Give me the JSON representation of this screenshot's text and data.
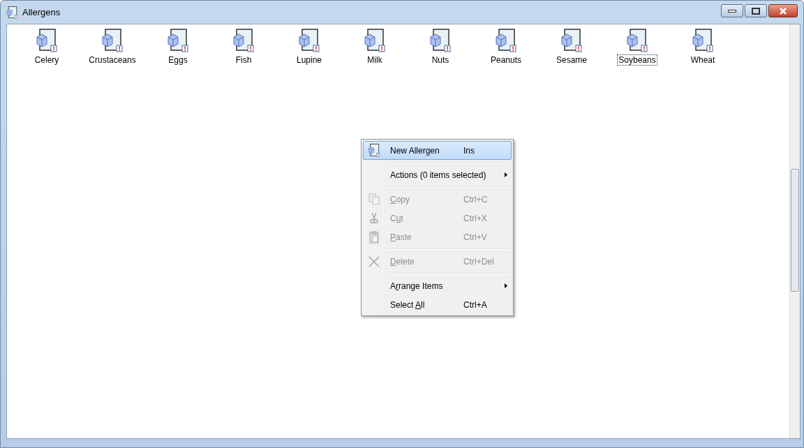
{
  "window": {
    "title": "Allergens"
  },
  "items": [
    {
      "label": "Celery",
      "focused": false
    },
    {
      "label": "Crustaceans",
      "focused": false
    },
    {
      "label": "Eggs",
      "focused": false
    },
    {
      "label": "Fish",
      "focused": false
    },
    {
      "label": "Lupine",
      "focused": false
    },
    {
      "label": "Milk",
      "focused": false
    },
    {
      "label": "Nuts",
      "focused": false
    },
    {
      "label": "Peanuts",
      "focused": false
    },
    {
      "label": "Sesame",
      "focused": false
    },
    {
      "label": "Soybeans",
      "focused": true
    },
    {
      "label": "Wheat",
      "focused": false
    }
  ],
  "context_menu": [
    {
      "kind": "new",
      "label_start": "New Allergen",
      "shortcut": "Ins",
      "selected": true,
      "disabled": false
    },
    {
      "kind": "separator"
    },
    {
      "kind": "submenu",
      "label_start": "Actions (0 items selected)",
      "selected": false,
      "disabled": false
    },
    {
      "kind": "separator"
    },
    {
      "kind": "copy",
      "mnemonic": "C",
      "label_end": "opy",
      "shortcut": "Ctrl+C",
      "selected": false,
      "disabled": true
    },
    {
      "kind": "cut",
      "label_start": "C",
      "mnemonic": "u",
      "label_end": "t",
      "shortcut": "Ctrl+X",
      "selected": false,
      "disabled": true
    },
    {
      "kind": "paste",
      "mnemonic": "P",
      "label_end": "aste",
      "shortcut": "Ctrl+V",
      "selected": false,
      "disabled": true
    },
    {
      "kind": "separator"
    },
    {
      "kind": "delete",
      "mnemonic": "D",
      "label_end": "elete",
      "shortcut": "Ctrl+Del",
      "selected": false,
      "disabled": true
    },
    {
      "kind": "separator"
    },
    {
      "kind": "submenu",
      "label_start": "A",
      "mnemonic": "r",
      "label_end": "range Items",
      "selected": false,
      "disabled": false
    },
    {
      "kind": "plain",
      "label_start": "Select ",
      "mnemonic": "A",
      "label_end": "ll",
      "shortcut": "Ctrl+A",
      "selected": false,
      "disabled": false
    }
  ]
}
